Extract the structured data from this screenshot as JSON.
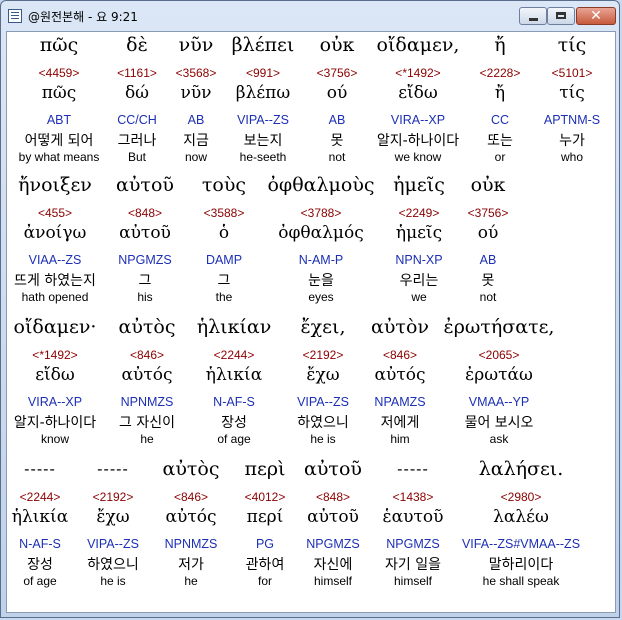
{
  "window": {
    "title": "@원전본해 - 요 9:21"
  },
  "controls": {
    "minimize": "minimize",
    "maximize": "maximize",
    "close": "✕"
  },
  "rows": [
    {
      "words": [
        {
          "gk": "πῶς",
          "num": "<4459>",
          "lem": "πῶς",
          "mor": "ABT",
          "kr": "어떻게 되어",
          "en": "by what means"
        },
        {
          "gk": "δὲ",
          "num": "<1161>",
          "lem": "δώ",
          "mor": "CC/CH",
          "kr": "그러나",
          "en": "But"
        },
        {
          "gk": "νῦν",
          "num": "<3568>",
          "lem": "νῦν",
          "mor": "AB",
          "kr": "지금",
          "en": "now"
        },
        {
          "gk": "βλέπει",
          "num": "<991>",
          "lem": "βλέπω",
          "mor": "VIPA--ZS",
          "kr": "보는지",
          "en": "he-seeth"
        },
        {
          "gk": "οὐκ",
          "num": "<3756>",
          "lem": "ού",
          "mor": "AB",
          "kr": "못",
          "en": "not"
        },
        {
          "gk": "οἴδαμεν,",
          "num": "<*1492>",
          "lem": "εἴδω",
          "mor": "VIRA--XP",
          "kr": "알지-하나이다",
          "en": "we know"
        },
        {
          "gk": "ἤ",
          "num": "<2228>",
          "lem": "ἤ",
          "mor": "CC",
          "kr": "또는",
          "en": "or"
        },
        {
          "gk": "τίς",
          "num": "<5101>",
          "lem": "τίς",
          "mor": "APTNM-S",
          "kr": "누가",
          "en": "who"
        }
      ]
    },
    {
      "words": [
        {
          "gk": "ἤνοιξεν",
          "num": "<455>",
          "lem": "ἀνοίγω",
          "mor": "VIAA--ZS",
          "kr": "뜨게 하였는지",
          "en": "hath opened"
        },
        {
          "gk": "αὐτοῦ",
          "num": "<848>",
          "lem": "αὐτοῦ",
          "mor": "NPGMZS",
          "kr": "그",
          "en": "his"
        },
        {
          "gk": "τοὺς",
          "num": "<3588>",
          "lem": "ὁ",
          "mor": "DAMP",
          "kr": "그",
          "en": "the"
        },
        {
          "gk": "ὀφθαλμοὺς",
          "num": "<3788>",
          "lem": "ὀφθαλμός",
          "mor": "N-AM-P",
          "kr": "눈을",
          "en": "eyes"
        },
        {
          "gk": "ἡμεῖς",
          "num": "<2249>",
          "lem": "ἡμεῖς",
          "mor": "NPN-XP",
          "kr": "우리는",
          "en": "we"
        },
        {
          "gk": "οὐκ",
          "num": "<3756>",
          "lem": "ού",
          "mor": "AB",
          "kr": "못",
          "en": "not"
        }
      ]
    },
    {
      "words": [
        {
          "gk": "οἴδαμεν·",
          "num": "<*1492>",
          "lem": "εἴδω",
          "mor": "VIRA--XP",
          "kr": "알지-하나이다",
          "en": "know"
        },
        {
          "gk": "αὐτὸς",
          "num": "<846>",
          "lem": "αὐτός",
          "mor": "NPNMZS",
          "kr": "그 자신이",
          "en": "he"
        },
        {
          "gk": "ἡλικίαν",
          "num": "<2244>",
          "lem": "ἡλικία",
          "mor": "N-AF-S",
          "kr": "장성",
          "en": "of age"
        },
        {
          "gk": "ἔχει,",
          "num": "<2192>",
          "lem": "ἔχω",
          "mor": "VIPA--ZS",
          "kr": "하였으니",
          "en": "he is"
        },
        {
          "gk": "αὐτὸν",
          "num": "<846>",
          "lem": "αὐτός",
          "mor": "NPAMZS",
          "kr": "저에게",
          "en": "him"
        },
        {
          "gk": "ἐρωτήσατε,",
          "num": "<2065>",
          "lem": "ἐρωτάω",
          "mor": "VMAA--YP",
          "kr": "물어 보시오",
          "en": "ask"
        }
      ]
    },
    {
      "words": [
        {
          "gk": "-----",
          "num": "<2244>",
          "lem": "ἡλικία",
          "mor": "N-AF-S",
          "kr": "장성",
          "en": "of age"
        },
        {
          "gk": "-----",
          "num": "<2192>",
          "lem": "ἔχω",
          "mor": "VIPA--ZS",
          "kr": "하였으니",
          "en": "he is"
        },
        {
          "gk": "αὐτὸς",
          "num": "<846>",
          "lem": "αὐτός",
          "mor": "NPNMZS",
          "kr": "저가",
          "en": "he"
        },
        {
          "gk": "περὶ",
          "num": "<4012>",
          "lem": "περί",
          "mor": "PG",
          "kr": "관하여",
          "en": "for"
        },
        {
          "gk": "αὐτοῦ",
          "num": "<848>",
          "lem": "αὐτοῦ",
          "mor": "NPGMZS",
          "kr": "자신에",
          "en": "himself"
        },
        {
          "gk": "-----",
          "num": "<1438>",
          "lem": "ἑαυτοῦ",
          "mor": "NPGMZS",
          "kr": "자기 일을",
          "en": "himself"
        },
        {
          "gk": "λαλήσει.",
          "num": "<2980>",
          "lem": "λαλέω",
          "mor": "VIFA--ZS#VMAA--ZS",
          "kr": "말하리이다",
          "en": "he shall speak"
        }
      ]
    }
  ]
}
